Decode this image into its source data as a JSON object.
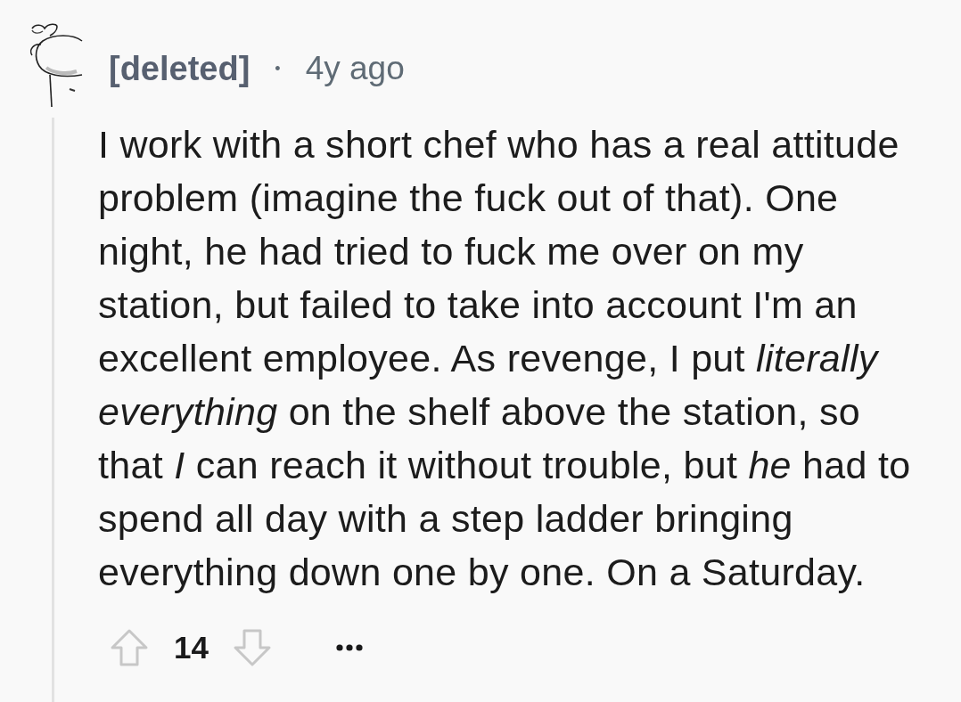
{
  "comment": {
    "author": "[deleted]",
    "separator": "•",
    "time": "4y ago",
    "body": "I work with a short chef who has a real attitude problem (imagine the fuck out of that). One night, he had tried to fuck me over on my station, but failed to take into account I'm an excellent employee. As revenge, I put *literally everything* on the shelf above the station, so that *I* can reach it without trouble, but *he* had to spend all day with a step ladder bringing everything down one by one. On a Saturday.",
    "score": "14"
  }
}
